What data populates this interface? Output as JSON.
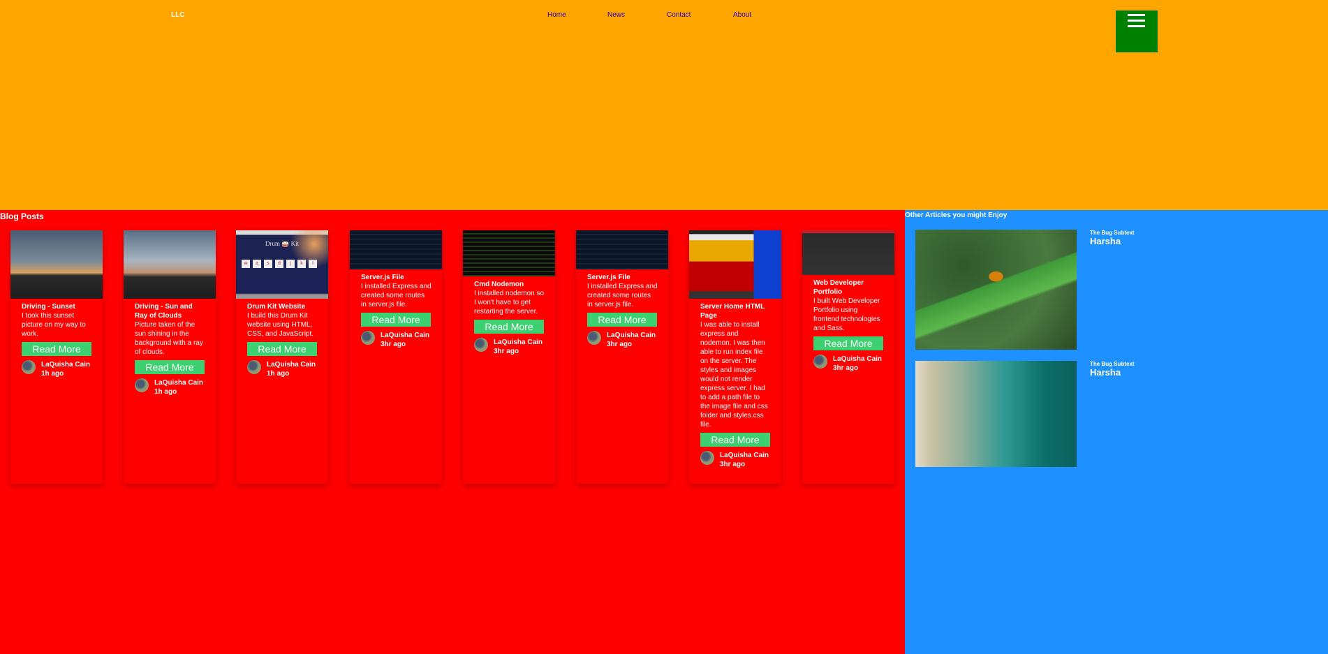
{
  "header": {
    "logo": "LLC",
    "nav": [
      "Home",
      "News",
      "Contact",
      "About"
    ],
    "menu_icon": "hamburger-icon",
    "background": "#ffa500"
  },
  "blog": {
    "title": "Blog Posts",
    "background": "#ff0000",
    "posts": [
      {
        "title": "Driving - Sunset",
        "text": "I took this sunset picture on my way to work.",
        "button": "Read More",
        "author": "LaQuisha Cain",
        "time": "1h ago"
      },
      {
        "title": "Driving - Sun and Ray of Clouds",
        "text": "Picture taken of the sun shining in the background with a ray of clouds.",
        "button": "Read More",
        "author": "LaQuisha Cain",
        "time": "1h ago"
      },
      {
        "title": "Drum Kit Website",
        "text": "I build this Drum Kit website using HTML, CSS, and JavaScript.",
        "button": "Read More",
        "author": "LaQuisha Cain",
        "time": "1h ago",
        "image_text": "Drum 🥁 Kit",
        "keys": [
          "w",
          "a",
          "s",
          "d",
          "j",
          "k",
          "l"
        ]
      },
      {
        "title": "Server.js File",
        "text": "I installed Express and created some routes in server.js file.",
        "button": "Read More",
        "author": "LaQuisha Cain",
        "time": "3hr ago"
      },
      {
        "title": "Cmd Nodemon",
        "text": "I installed nodemon so I won't have to get restarting the server.",
        "button": "Read More",
        "author": "LaQuisha Cain",
        "time": "3hr ago"
      },
      {
        "title": "Server.js File",
        "text": "I installed Express and created some routes in server.js file.",
        "button": "Read More",
        "author": "LaQuisha Cain",
        "time": "3hr ago"
      },
      {
        "title": "Server Home HTML Page",
        "text": "I was able to install express and nodemon. I was then able to run index file on the server. The styles and images would not render express server. I had to add a path file to the image file and css folder and styles.css file.",
        "button": "Read More",
        "author": "LaQuisha Cain",
        "time": "3hr ago"
      },
      {
        "title": "Web Developer Portfolio",
        "text": "I built Web Developer Portfolio using frontend technologies and Sass.",
        "button": "Read More",
        "author": "LaQuisha Cain",
        "time": "3hr ago"
      }
    ]
  },
  "aside": {
    "title": "Other Articles you might Enjoy",
    "background": "#1e90ff",
    "articles": [
      {
        "subtext": "The Bug Subtext",
        "name": "Harsha"
      },
      {
        "subtext": "The Bug Subtext",
        "name": "Harsha"
      }
    ]
  },
  "colors": {
    "button": "#3cd070",
    "menu": "#008000"
  }
}
